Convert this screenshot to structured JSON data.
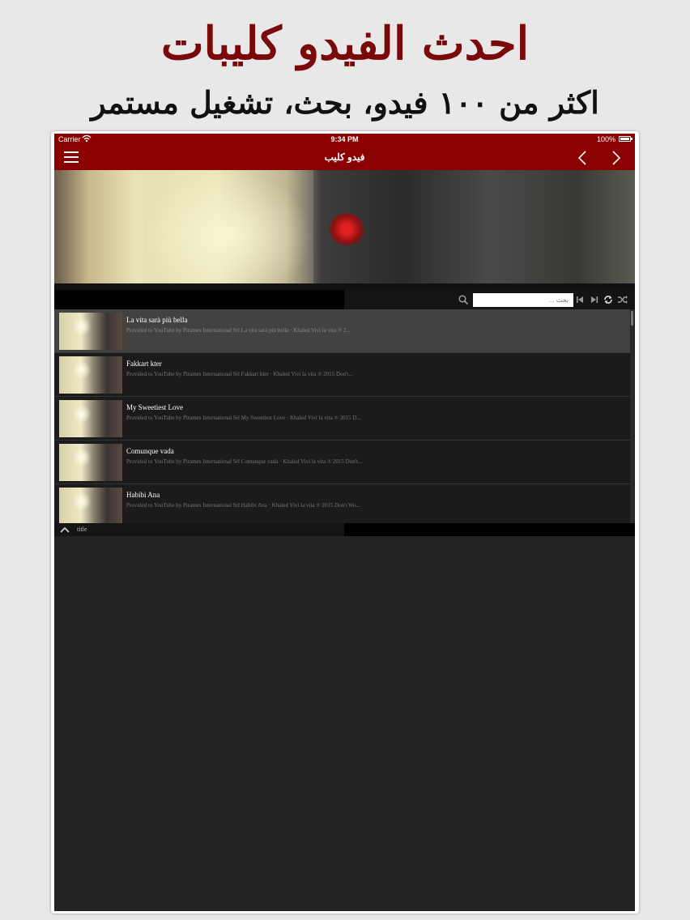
{
  "promo": {
    "headline": "احدث الفيدو كليبات",
    "subheadline": "اكثر من ١٠٠ فيدو، بحث، تشغيل مستمر"
  },
  "status_bar": {
    "carrier": "Carrier",
    "time": "9:34 PM",
    "battery": "100%"
  },
  "nav": {
    "title": "فيدو كليب",
    "menu_icon": "hamburger-icon",
    "back_icon": "chevron-left-icon",
    "forward_icon": "chevron-right-icon"
  },
  "toolbar": {
    "search_placeholder": "بحث ...",
    "icons": [
      "search-icon",
      "skip-previous-icon",
      "skip-next-icon",
      "repeat-icon",
      "shuffle-icon"
    ]
  },
  "videos": [
    {
      "title": "La vita sarà più bella",
      "description": "Provided to YouTube by Pirames International Srl La vita sarà più bella · Khaled Vivi la vita ℗ 2..."
    },
    {
      "title": "Fakkart kter",
      "description": "Provided to YouTube by Pirames International Srl Fakkart kter · Khaled Vivi la vita ℗ 2015 Don't..."
    },
    {
      "title": "My Sweetiest Love",
      "description": "Provided to YouTube by Pirames International Srl My Sweetiest Love · Khaled Vivi la vita ℗ 2015 D..."
    },
    {
      "title": "Comunque vada",
      "description": "Provided to YouTube by Pirames International Srl Comunque vada · Khaled Vivi la vita ℗ 2015 Don't..."
    },
    {
      "title": "Habibi Ana",
      "description": "Provided to YouTube by Pirames International Srl Habibi Ana · Khaled Vivi la vita ℗ 2015 Don't Wo..."
    }
  ],
  "bottom_bar": {
    "label": "title"
  },
  "colors": {
    "brand_red": "#8b0000",
    "headline_red": "#7a0a0a",
    "background": "#232323",
    "selected_row": "#434243"
  }
}
